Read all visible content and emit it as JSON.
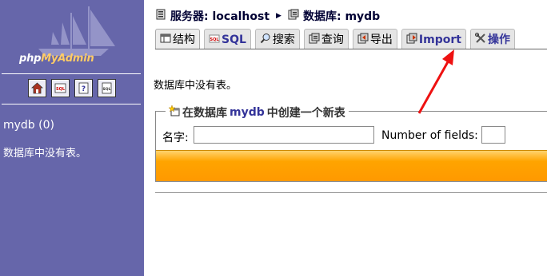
{
  "sidebar": {
    "logo": {
      "prefix": "php",
      "accent": "MyAdmin"
    },
    "nav_icons": [
      "home-icon",
      "sql-query-icon",
      "help-icon",
      "sql-doc-icon"
    ],
    "database_link": "mydb (0)",
    "no_tables_text": "数据库中没有表。"
  },
  "breadcrumb": {
    "server_label": "服务器: localhost",
    "database_label": "数据库: mydb"
  },
  "tabs": [
    {
      "label": "结构",
      "icon": "structure-icon",
      "active": true
    },
    {
      "label": "SQL",
      "icon": "sql-icon"
    },
    {
      "label": "搜索",
      "icon": "search-icon"
    },
    {
      "label": "查询",
      "icon": "query-icon"
    },
    {
      "label": "导出",
      "icon": "export-icon"
    },
    {
      "label": "Import",
      "icon": "import-icon"
    },
    {
      "label": "操作",
      "icon": "operations-icon"
    }
  ],
  "main": {
    "no_tables_text": "数据库中没有表。",
    "create_table": {
      "legend_prefix": "在数据库",
      "legend_db": "mydb",
      "legend_suffix": "中创建一个新表",
      "name_label": "名字:",
      "name_value": "",
      "fields_label": "Number of fields:",
      "fields_value": ""
    }
  },
  "colors": {
    "sidebar_bg": "#6666aa",
    "orange_bar": "#ff9900",
    "annotation_arrow": "#ee1111"
  }
}
